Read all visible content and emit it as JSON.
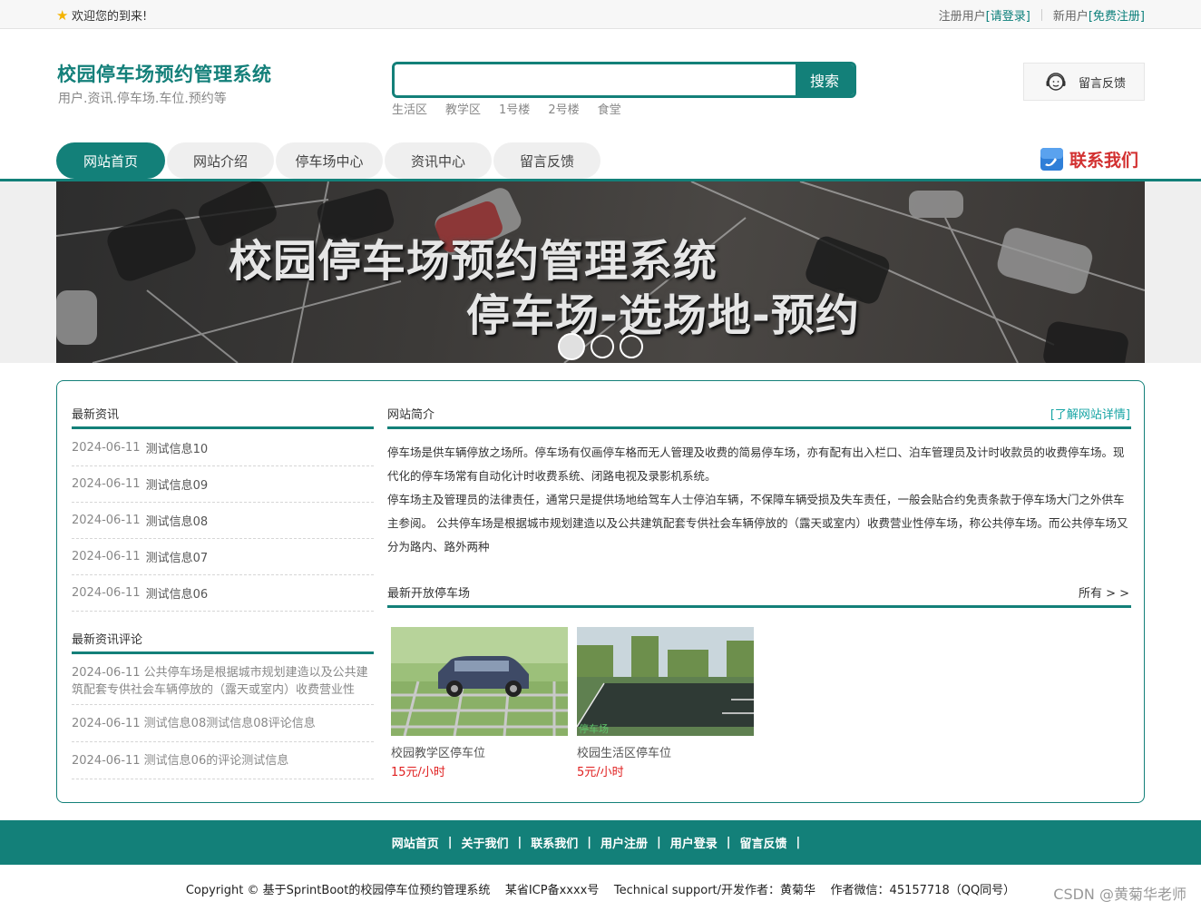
{
  "topbar": {
    "welcome": "欢迎您的到来!",
    "register_label": "注册用户",
    "login_link": "[请登录]",
    "new_user_label": "新用户",
    "signup_link": "[免费注册]"
  },
  "header": {
    "title": "校园停车场预约管理系统",
    "subtitle": "用户.资讯.停车场.车位.预约等",
    "search_placeholder": "",
    "search_button": "搜索",
    "hot_words": [
      "生活区",
      "教学区",
      "1号楼",
      "2号楼",
      "食堂"
    ],
    "feedback_button": "留言反馈"
  },
  "nav": {
    "items": [
      "网站首页",
      "网站介绍",
      "停车场中心",
      "资讯中心",
      "留言反馈"
    ],
    "contact": "联系我们"
  },
  "banner": {
    "line1": "校园停车场预约管理系统",
    "line2": "停车场-选场地-预约"
  },
  "news": {
    "title": "最新资讯",
    "items": [
      {
        "date": "2024-06-11",
        "title": "测试信息10"
      },
      {
        "date": "2024-06-11",
        "title": "测试信息09"
      },
      {
        "date": "2024-06-11",
        "title": "测试信息08"
      },
      {
        "date": "2024-06-11",
        "title": "测试信息07"
      },
      {
        "date": "2024-06-11",
        "title": "测试信息06"
      }
    ]
  },
  "comments": {
    "title": "最新资讯评论",
    "items": [
      "2024-06-11 公共停车场是根据城市规划建造以及公共建筑配套专供社会车辆停放的（露天或室内）收费营业性",
      "2024-06-11 测试信息08测试信息08评论信息",
      "2024-06-11 测试信息06的评论测试信息"
    ]
  },
  "intro": {
    "title": "网站简介",
    "more": "[了解网站详情]",
    "para1": "停车场是供车辆停放之场所。停车场有仅画停车格而无人管理及收费的简易停车场，亦有配有出入栏口、泊车管理员及计时收款员的收费停车场。现代化的停车场常有自动化计时收费系统、闭路电视及录影机系统。",
    "para2": "停车场主及管理员的法律责任，通常只是提供场地给驾车人士停泊车辆，不保障车辆受损及失车责任，一般会贴合约免责条款于停车场大门之外供车主参阅。 公共停车场是根据城市规划建造以及公共建筑配套专供社会车辆停放的（露天或室内）收费营业性停车场，称公共停车场。而公共停车场又分为路内、路外两种"
  },
  "lots": {
    "title": "最新开放停车场",
    "more": "所有 > >",
    "items": [
      {
        "name": "校园教学区停车位",
        "price": "15元/小时"
      },
      {
        "name": "校园生活区停车位",
        "price": "5元/小时",
        "sign": "停车场"
      }
    ]
  },
  "footer": {
    "links": [
      "网站首页",
      "关于我们",
      "联系我们",
      "用户注册",
      "用户登录",
      "留言反馈"
    ],
    "copyright": "Copyright © 基于SprintBoot的校园停车位预约管理系统    某省ICP备xxxx号    Technical support/开发作者：黄菊华    作者微信：45157718（QQ同号）",
    "watermark": "CSDN @黄菊华老师"
  },
  "colors": {
    "primary": "#138079",
    "price": "#e02020",
    "contact": "#d23030"
  }
}
